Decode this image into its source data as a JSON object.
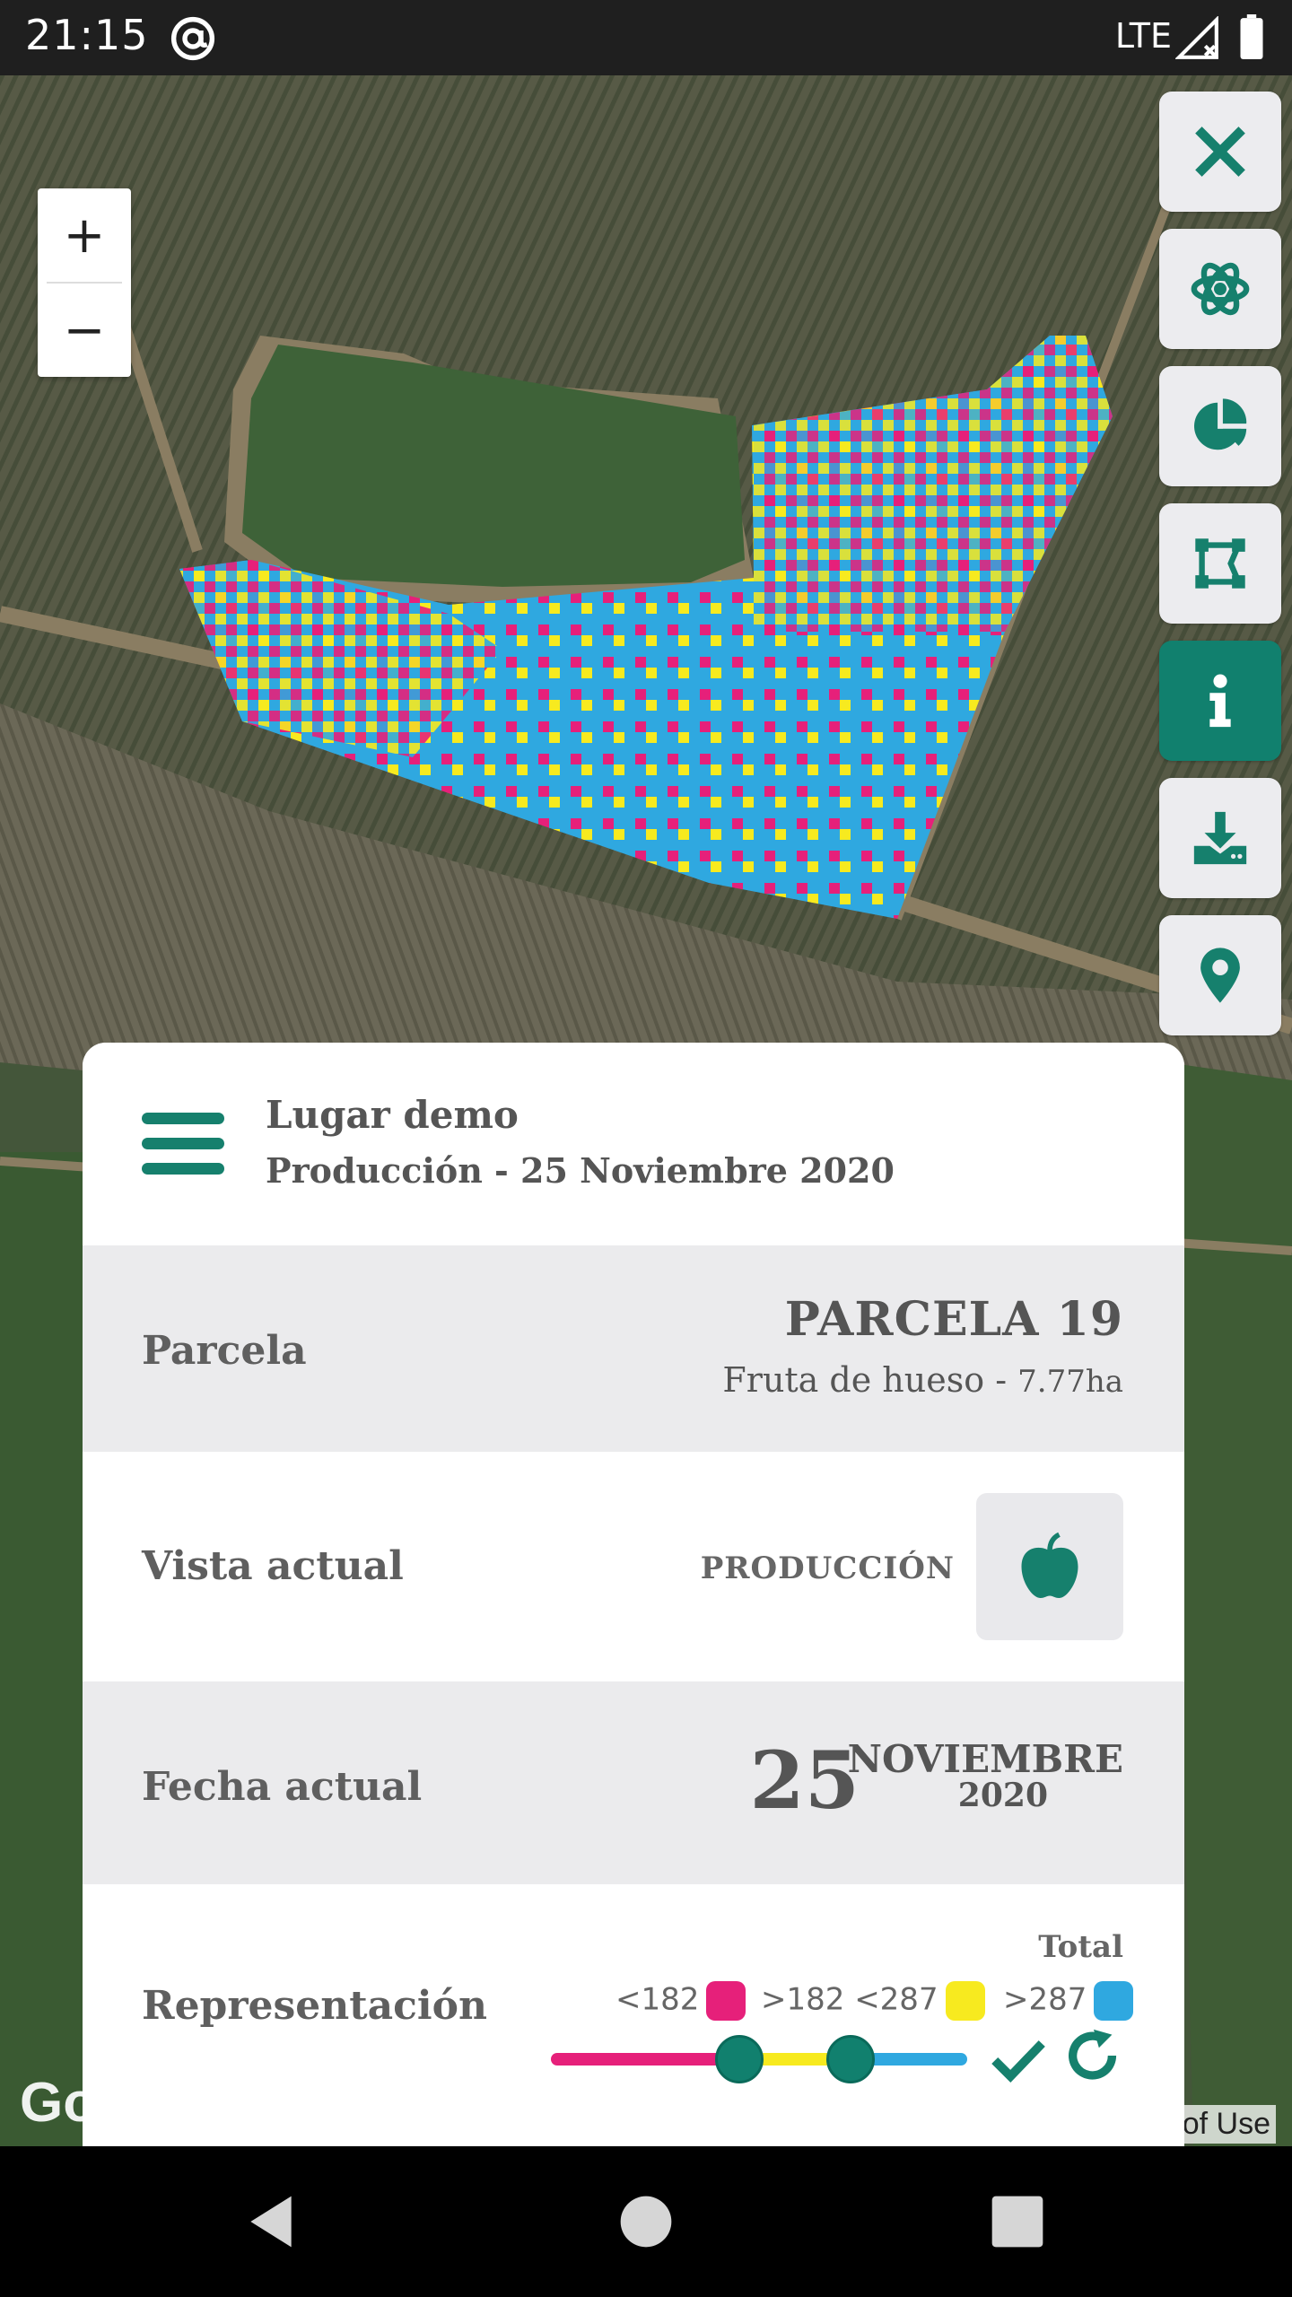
{
  "status_bar": {
    "time": "21:15",
    "network": "LTE",
    "icons": [
      "at-sign-icon",
      "signal-icon",
      "battery-icon"
    ]
  },
  "map": {
    "attribution": "Go",
    "terms": "of Use",
    "zoom_in_label": "+",
    "zoom_out_label": "−",
    "overlay_colors": {
      "low": "#e6207a",
      "mid": "#f7ea1f",
      "high": "#2fa8e0"
    }
  },
  "toolbar": {
    "items": [
      {
        "name": "close-icon",
        "active": false
      },
      {
        "name": "atom-icon",
        "active": false
      },
      {
        "name": "pie-chart-icon",
        "active": false
      },
      {
        "name": "polygon-edit-icon",
        "active": false
      },
      {
        "name": "info-icon",
        "active": true
      },
      {
        "name": "download-icon",
        "active": false
      },
      {
        "name": "location-pin-icon",
        "active": false
      }
    ],
    "accent": "#11806e"
  },
  "panel": {
    "site": "Lugar demo",
    "subtitle": "Producción - 25 Noviembre 2020",
    "parcela": {
      "label": "Parcela",
      "name": "PARCELA 19",
      "crop": "Fruta de hueso - ",
      "area": "7.77",
      "area_unit": "ha"
    },
    "vista": {
      "label": "Vista actual",
      "value": "PRODUCCIÓN",
      "icon": "apple-icon"
    },
    "fecha": {
      "label": "Fecha actual",
      "day": "25",
      "month": "NOVIEMBRE",
      "year": "2020"
    },
    "representacion": {
      "label": "Representación",
      "total_label": "Total",
      "legend": [
        {
          "text": "<182",
          "color": "#e6207a"
        },
        {
          "text": ">182 <287",
          "color": "#f7ea1f"
        },
        {
          "text": ">287",
          "color": "#2fa8e0"
        }
      ]
    }
  },
  "nav": {
    "icons": [
      "back-icon",
      "home-icon",
      "recents-icon"
    ]
  }
}
